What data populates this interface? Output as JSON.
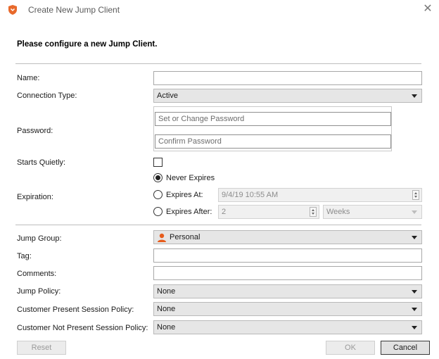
{
  "window": {
    "title": "Create New Jump Client",
    "close_label": "✕"
  },
  "form": {
    "heading": "Please configure a new Jump Client.",
    "name": {
      "label": "Name:",
      "value": ""
    },
    "connection_type": {
      "label": "Connection Type:",
      "value": "Active"
    },
    "password": {
      "label": "Password:",
      "placeholder": "Set or Change Password",
      "confirm_placeholder": "Confirm Password"
    },
    "starts_quietly": {
      "label": "Starts Quietly:",
      "checked": false
    },
    "expiration": {
      "label": "Expiration:",
      "never_label": "Never Expires",
      "at_label": "Expires At:",
      "at_value": "9/4/19 10:55 AM",
      "after_label": "Expires After:",
      "after_value": "2",
      "after_unit": "Weeks",
      "selected": "never"
    },
    "jump_group": {
      "label": "Jump Group:",
      "value": "Personal"
    },
    "tag": {
      "label": "Tag:",
      "value": ""
    },
    "comments": {
      "label": "Comments:",
      "value": ""
    },
    "jump_policy": {
      "label": "Jump Policy:",
      "value": "None"
    },
    "customer_present_policy": {
      "label": "Customer Present Session Policy:",
      "value": "None"
    },
    "customer_not_present_policy": {
      "label": "Customer Not Present Session Policy:",
      "value": "None"
    }
  },
  "buttons": {
    "reset": "Reset",
    "ok": "OK",
    "cancel": "Cancel"
  },
  "colors": {
    "icon_orange": "#e8692b",
    "person_orange": "#e65c1c"
  }
}
